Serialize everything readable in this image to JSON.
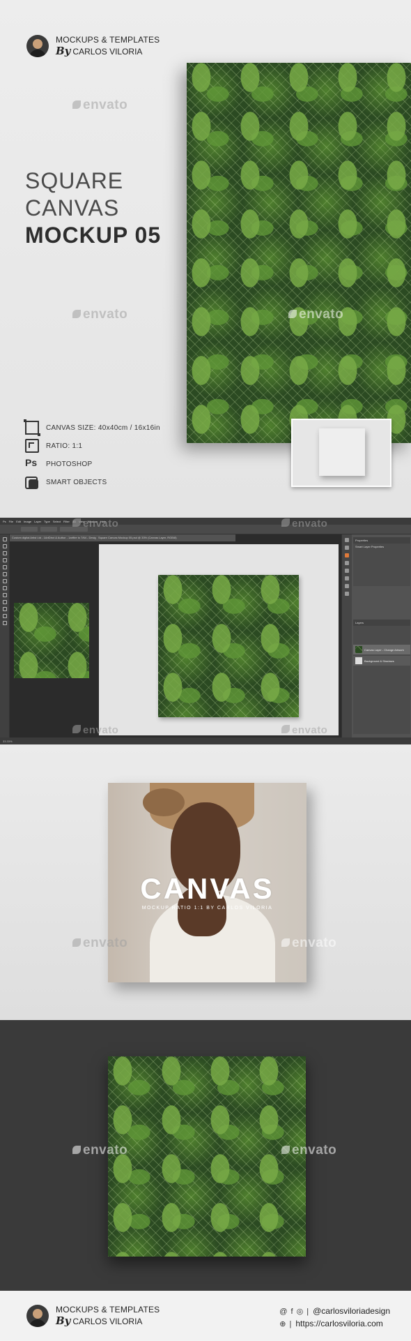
{
  "brand": {
    "line1": "MOCKUPS & TEMPLATES",
    "by": "By",
    "author": "CARLOS VILORIA"
  },
  "title": {
    "line1": "SQUARE",
    "line2": "CANVAS",
    "line3": "MOCKUP 05"
  },
  "features": [
    {
      "icon": "canvas-size-icon",
      "label": "CANVAS SIZE: 40x40cm  / 16x16in"
    },
    {
      "icon": "ratio-icon",
      "label": "RATIO: 1:1"
    },
    {
      "icon": "photoshop-icon",
      "icon_text": "Ps",
      "label": "PHOTOSHOP"
    },
    {
      "icon": "smart-objects-icon",
      "label": "SMART OBJECTS"
    }
  ],
  "watermark": "envato",
  "photoshop": {
    "menu": [
      "Ps",
      "File",
      "Edit",
      "Image",
      "Layer",
      "Type",
      "Select",
      "Filter",
      "3D",
      "View",
      "Window",
      "Help"
    ],
    "tab1": "Custom digital Artist Ltd - 1ArtDirct & Author - 1artfire to 7/64 - Design.psb",
    "tab2": "Square Canvas Mockup 05.psd @ 33% (Canvas Layer, RGB/8)",
    "zoom": "33.33%",
    "panel_title": "Properties",
    "panel_sub": "Smart Layer Properties",
    "layers_title": "Layers",
    "layers": [
      "Canvas Layer - Change Artwork",
      "Background & Shadows"
    ]
  },
  "photo_card": {
    "title": "CANVAS",
    "subtitle": "MOCKUP RATIO 1:1 BY CARLOS VILORIA"
  },
  "footer": {
    "social_icons": "@ f ◎ |",
    "handle": "@carlosviloriadesign",
    "web_icon": "⊕ |",
    "url": "https://carlosviloria.com"
  },
  "colors": {
    "accent_orange": "#e07a3a",
    "dark_bg": "#3a3a3a",
    "light_bg": "#e9e9e9"
  }
}
